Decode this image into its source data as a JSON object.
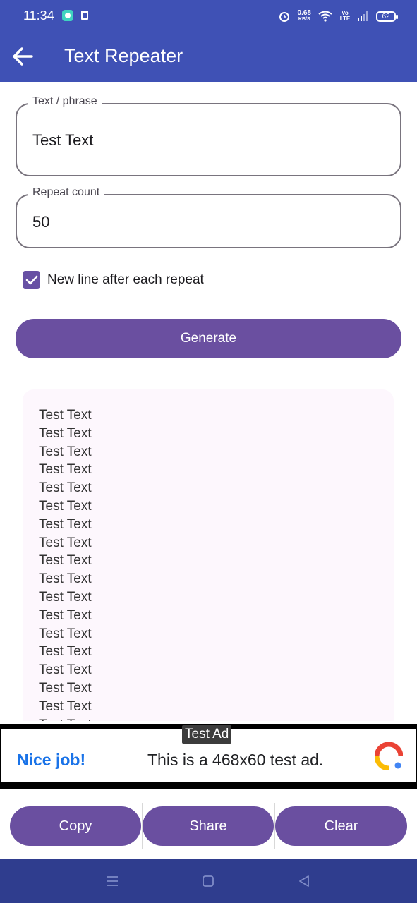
{
  "status_bar": {
    "time": "11:34",
    "net_speed_value": "0.68",
    "net_speed_unit": "KB/S",
    "volte": "Vo LTE",
    "battery": "62"
  },
  "app_bar": {
    "title": "Text Repeater",
    "back_icon": "arrow-back-icon"
  },
  "form": {
    "text_field_label": "Text / phrase",
    "text_field_value": "Test Text",
    "count_field_label": "Repeat count",
    "count_field_value": "50",
    "newline_checkbox_label": "New line after each repeat",
    "newline_checked": true,
    "generate_label": "Generate"
  },
  "output": {
    "lines": [
      "Test Text",
      "Test Text",
      "Test Text",
      "Test Text",
      "Test Text",
      "Test Text",
      "Test Text",
      "Test Text",
      "Test Text",
      "Test Text",
      "Test Text",
      "Test Text",
      "Test Text",
      "Test Text",
      "Test Text",
      "Test Text",
      "Test Text",
      "Test Text"
    ]
  },
  "ad": {
    "tag": "Test Ad",
    "headline": "Nice job!",
    "body": "This is a 468x60 test ad."
  },
  "actions": {
    "copy_label": "Copy",
    "share_label": "Share",
    "clear_label": "Clear"
  },
  "colors": {
    "app_bar": "#3f51b5",
    "primary_button": "#6a4fa0",
    "nav_bar": "#2f3d8e",
    "output_bg": "#fdf7fd"
  }
}
